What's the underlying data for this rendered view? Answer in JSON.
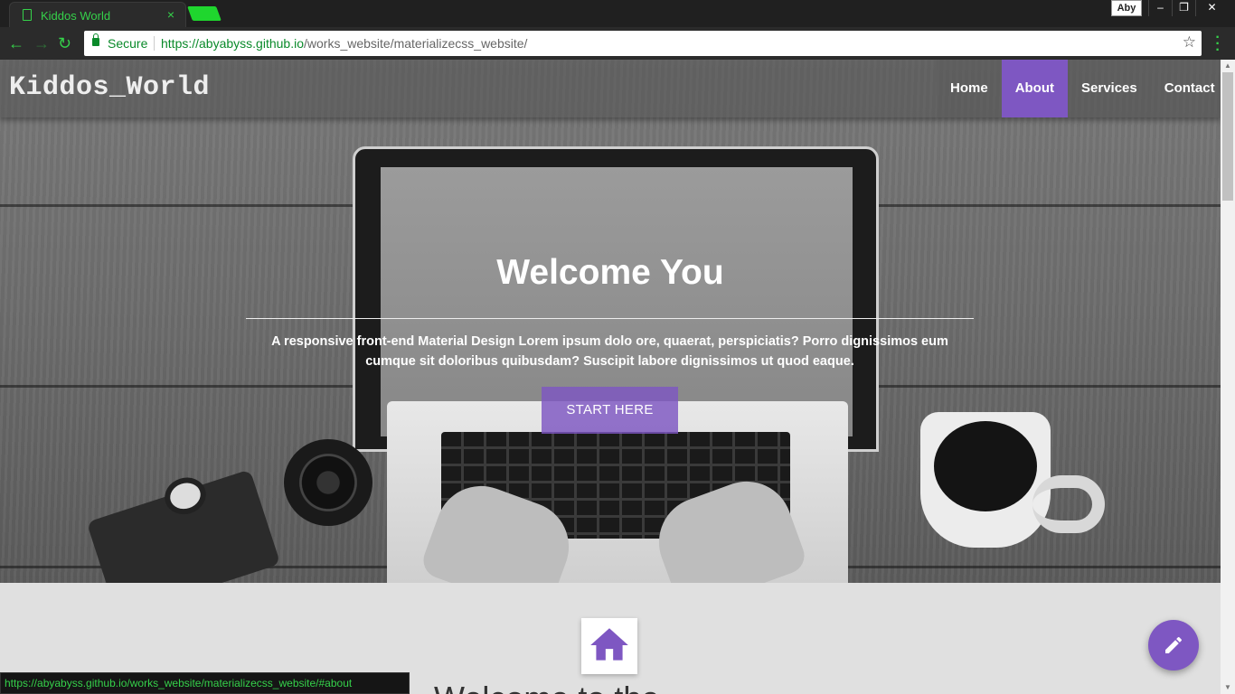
{
  "browser": {
    "tab_title": "Kiddos World",
    "tab_close": "×",
    "profile": "Aby",
    "window_buttons": [
      "–",
      "❐",
      "✕"
    ],
    "secure_label": "Secure",
    "url_scheme_host": "https://abyabyss.github.io",
    "url_path": "/works_website/materializecss_website/",
    "status_url": "https://abyabyss.github.io/works_website/materializecss_website/#about",
    "accent": "#35d14a"
  },
  "navbar": {
    "brand": "Kiddos_World",
    "links": [
      "Home",
      "About",
      "Services",
      "Contact"
    ],
    "active_link": "About",
    "active_color": "#7e57c2"
  },
  "hero": {
    "title": "Welcome You",
    "text": "A responsive front-end Material Design Lorem ipsum dolo ore, quaerat, perspiciatis? Porro dignissimos eum cumque sit doloribus quibusdam? Suscipit labore dignissimos ut quod eaque.",
    "button": "START HERE"
  },
  "section": {
    "icon": "home-icon",
    "heading_partial": "Welcome to the"
  },
  "fab": {
    "icon": "pencil-icon",
    "color": "#7e57c2"
  }
}
